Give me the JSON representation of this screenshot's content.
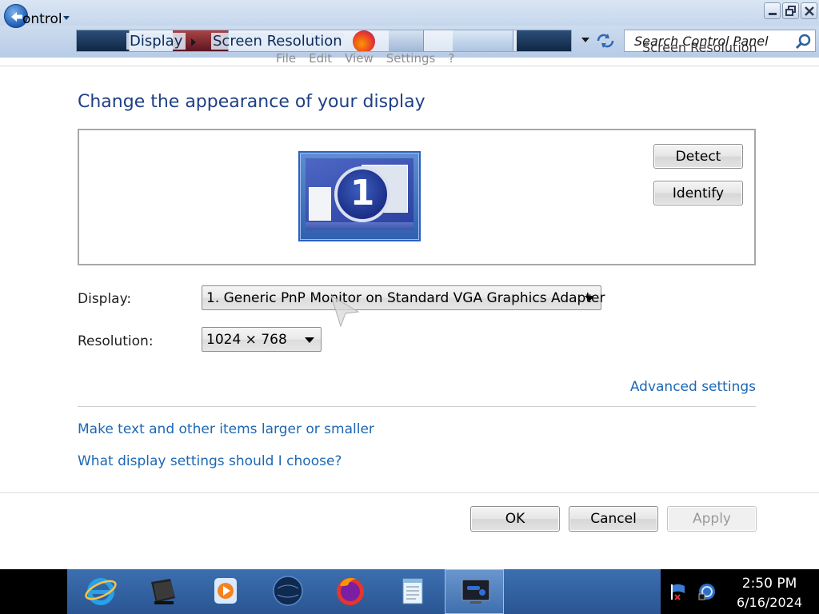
{
  "window": {
    "controls": [
      "minimize",
      "restore",
      "close"
    ]
  },
  "addressbar": {
    "back_label": "ontrol",
    "breadcrumbs": [
      "Display",
      "Screen Resolution"
    ],
    "search_placeholder": "Search Control Panel",
    "search_ghost_text": "Screen Resolution"
  },
  "menubar": {
    "items": [
      "File",
      "Edit",
      "View",
      "Settings",
      "?"
    ]
  },
  "main": {
    "title": "Change the appearance of your display",
    "monitor_number": "1",
    "detect_label": "Detect",
    "identify_label": "Identify",
    "display_label": "Display:",
    "display_value": "1. Generic PnP Monitor on Standard VGA Graphics Adapter",
    "resolution_label": "Resolution:",
    "resolution_value": "1024 × 768",
    "advanced_link": "Advanced settings",
    "link_larger": "Make text and other items larger or smaller",
    "link_choose": "What display settings should I choose?"
  },
  "footer": {
    "ok_label": "OK",
    "cancel_label": "Cancel",
    "apply_label": "Apply",
    "apply_enabled": false
  },
  "taskbar": {
    "items": [
      "internet-explorer-icon",
      "media-library-icon",
      "media-player-icon",
      "globe-icon",
      "firefox-icon",
      "notepad-icon",
      "display-settings-icon"
    ],
    "active_item": "display-settings-icon",
    "clock_time": "2:50 PM",
    "clock_date": "6/16/2024"
  },
  "colors": {
    "title": "#1e3f84",
    "link": "#1d67b4",
    "taskbar": "#2a5592"
  }
}
